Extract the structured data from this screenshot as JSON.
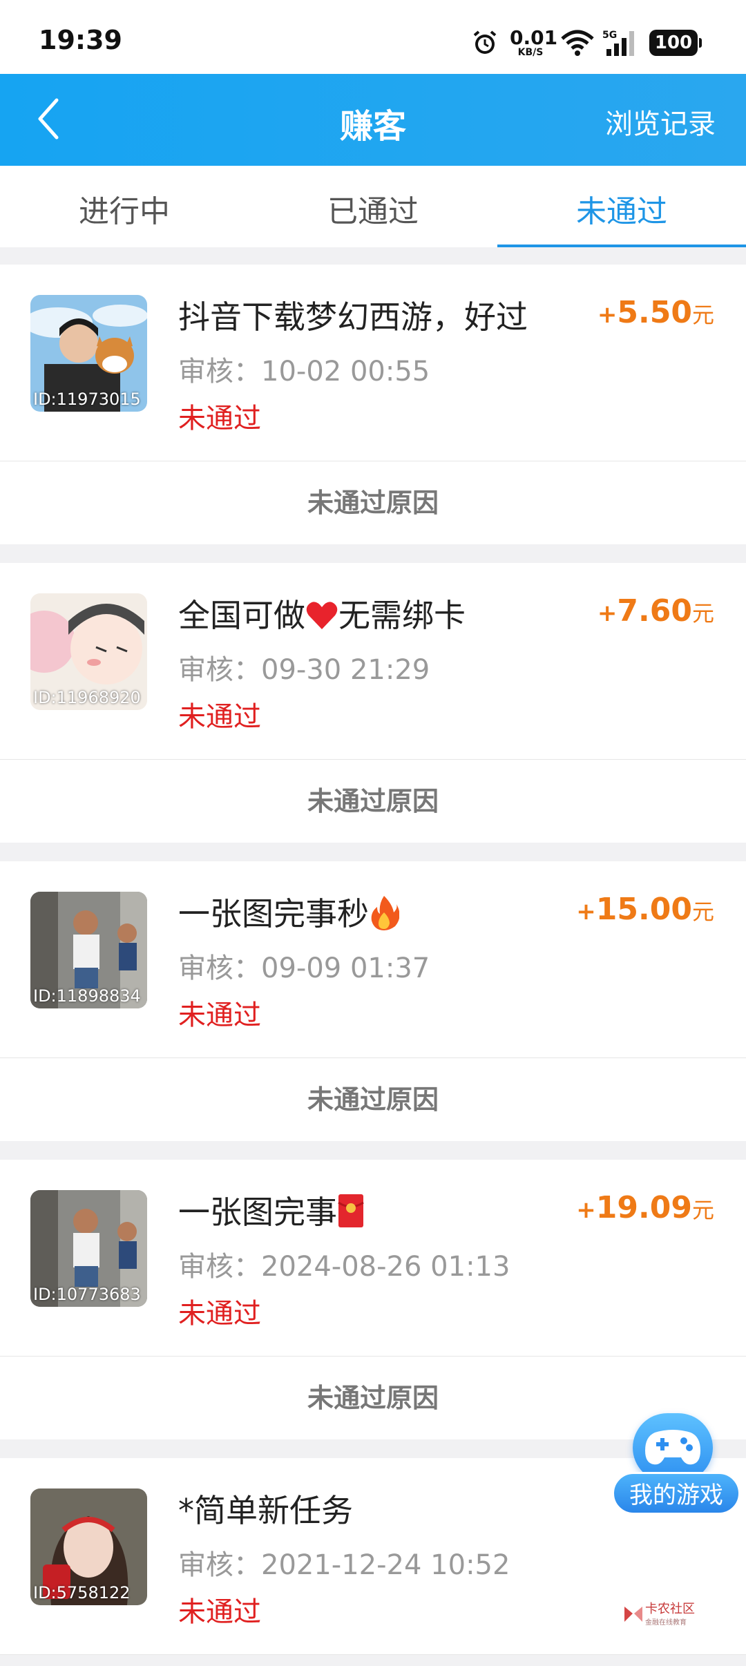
{
  "status_bar": {
    "time": "19:39",
    "net_speed_value": "0.01",
    "net_speed_unit": "KB/S",
    "battery": "100"
  },
  "header": {
    "title": "赚客",
    "history_label": "浏览记录"
  },
  "tabs": [
    {
      "label": "进行中",
      "active": false
    },
    {
      "label": "已通过",
      "active": false
    },
    {
      "label": "未通过",
      "active": true
    }
  ],
  "tasks": [
    {
      "name": "抖音下载梦幻西游，好过",
      "id_label": "ID:11973015",
      "reward_plus": "+",
      "reward_amount": "5.50",
      "reward_unit": "元",
      "review": "审核：10-02 00:55",
      "status": "未通过",
      "reason_label": "未通过原因"
    },
    {
      "name": "全国可做",
      "name_suffix": "无需绑卡",
      "id_label": "ID:11968920",
      "reward_plus": "+",
      "reward_amount": "7.60",
      "reward_unit": "元",
      "review": "审核：09-30 21:29",
      "status": "未通过",
      "reason_label": "未通过原因"
    },
    {
      "name": "一张图完事秒",
      "id_label": "ID:11898834",
      "reward_plus": "+",
      "reward_amount": "15.00",
      "reward_unit": "元",
      "review": "审核：09-09 01:37",
      "status": "未通过",
      "reason_label": "未通过原因"
    },
    {
      "name": "一张图完事",
      "id_label": "ID:10773683",
      "reward_plus": "+",
      "reward_amount": "19.09",
      "reward_unit": "元",
      "review": "审核：2024-08-26 01:13",
      "status": "未通过",
      "reason_label": "未通过原因"
    },
    {
      "name": "*简单新任务",
      "id_label": "ID:5758122",
      "review": "审核：2021-12-24 10:52",
      "status": "未通过"
    }
  ],
  "floating_button": {
    "label": "我的游戏",
    "icon": "gamepad-icon"
  },
  "watermark": {
    "text": "卡农社区",
    "subtext": "金融在线教育"
  },
  "colors": {
    "header_blue": "#16a4f2",
    "active_tab": "#1e95e6",
    "reward_orange": "#ef7a16",
    "status_red": "#e02020"
  }
}
